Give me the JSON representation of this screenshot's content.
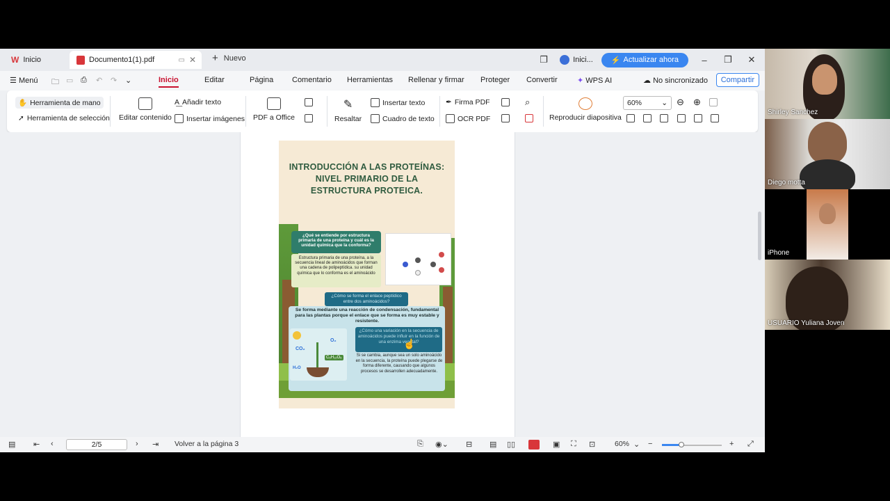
{
  "window": {
    "home_tab": "Inicio",
    "doc_tab": "Documento1(1).pdf",
    "new_tab": "Nuevo",
    "user": "Inici...",
    "upgrade": "Actualizar ahora"
  },
  "menu": {
    "items": [
      "Menú",
      "Inicio",
      "Editar",
      "Página",
      "Comentario",
      "Herramientas",
      "Rellenar y firmar",
      "Proteger",
      "Convertir",
      "WPS AI"
    ],
    "sync": "No sincronizado",
    "share": "Compartir"
  },
  "ribbon": {
    "hand_tool": "Herramienta de mano",
    "select_tool": "Herramienta de selección",
    "edit_content": "Editar contenido",
    "add_text": "Añadir texto",
    "insert_images": "Insertar imágenes",
    "pdf_to_office": "PDF a Office",
    "highlight": "Resaltar",
    "insert_text": "Insertar texto",
    "text_box": "Cuadro de texto",
    "sign_pdf": "Firma PDF",
    "ocr_pdf": "OCR PDF",
    "play_slides": "Reproducir diapositiva",
    "zoom": "60%"
  },
  "poster": {
    "title": "INTRODUCCIÓN A LAS PROTEÍNAS: NIVEL PRIMARIO DE LA ESTRUCTURA PROTEICA.",
    "q1": "¿Qué se entiende por estructura primaria de una proteína y cuál es la unidad química que la conforma?",
    "a1": "Estructura primaria de una proteína, a la secuencia lineal de aminoácidos que forman una cadena de polipeptídica. su unidad química que lo conforma es el aminoácido",
    "q2": "¿Cómo se forma el enlace peptídico entre dos aminoácidos?",
    "a2": "Se forma mediante una reacción de condensación, fundamental para las plantas porque el enlace que se forma es muy estable y resistente.",
    "q3": "¿Cómo una variación en la secuencia de aminoácidos puede influir en la función de una enzima vegetal?",
    "a3": "Si se cambia, aunque sea un solo aminoácido en la secuencia, la proteína puede plegarse de forma diferente, causando que algunos procesos se desarrollen adecuadamente.",
    "plant_labels": [
      "CO₂",
      "O₂",
      "C₆H₁₂O₆",
      "H₂O"
    ]
  },
  "status": {
    "page": "2/5",
    "goto": "Volver a la página 3",
    "zoom": "60%"
  },
  "participants": [
    "Shirley Sanchez",
    "Diego motta",
    "iPhone",
    "USUARIO Yuliana Joven"
  ]
}
